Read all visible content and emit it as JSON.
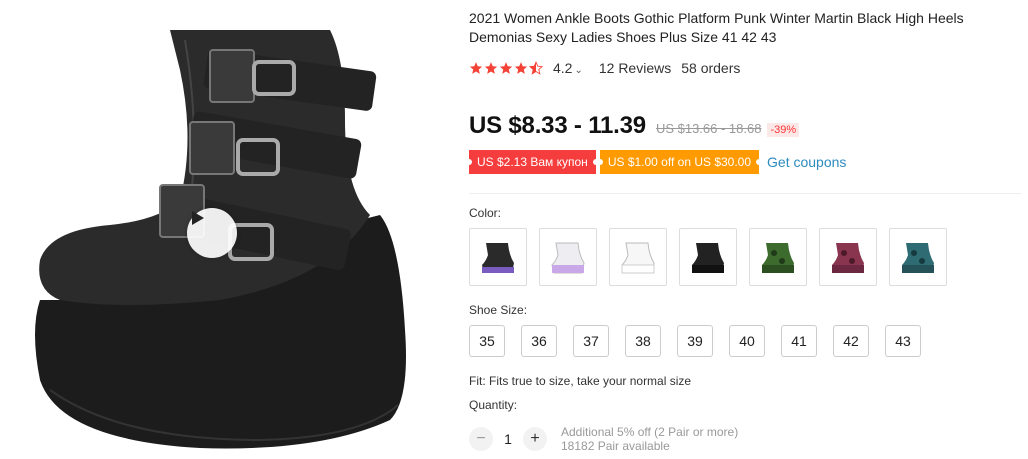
{
  "product": {
    "title": "2021 Women Ankle Boots Gothic Platform Punk Winter Martin Black High Heels Demonias Sexy Ladies Shoes Plus Size 41 42 43",
    "rating": "4.2",
    "reviews": "12 Reviews",
    "orders": "58 orders",
    "price": "US $8.33 - 11.39",
    "old_price": "US $13.66 - 18.68",
    "discount": "-39%"
  },
  "coupons": {
    "store_coupon": "US $2.13 Вам купон",
    "offer_coupon": "US $1.00 off on US $30.00",
    "get_coupons": "Get coupons"
  },
  "color": {
    "label": "Color:",
    "options": [
      "black-purple",
      "white-holographic",
      "white",
      "black",
      "green-camo",
      "pink-camo",
      "teal-camo"
    ],
    "colors": [
      "#4a4a5a",
      "#e8e8ee",
      "#f4f4f4",
      "#2a2a2a",
      "#3d6b2e",
      "#8a3550",
      "#2f6b72"
    ]
  },
  "size": {
    "label": "Shoe Size:",
    "options": [
      "35",
      "36",
      "37",
      "38",
      "39",
      "40",
      "41",
      "42",
      "43"
    ]
  },
  "fit": "Fit: Fits true to size, take your normal size",
  "quantity": {
    "label": "Quantity:",
    "minus": "−",
    "value": "1",
    "plus": "+",
    "note": "Additional 5% off (2 Pair or more)",
    "available": "18182 Pair available"
  },
  "theme": {
    "star": "#f44336",
    "link": "#2e8bc0",
    "red": "#f53d3d",
    "orange": "#ff9a00"
  }
}
